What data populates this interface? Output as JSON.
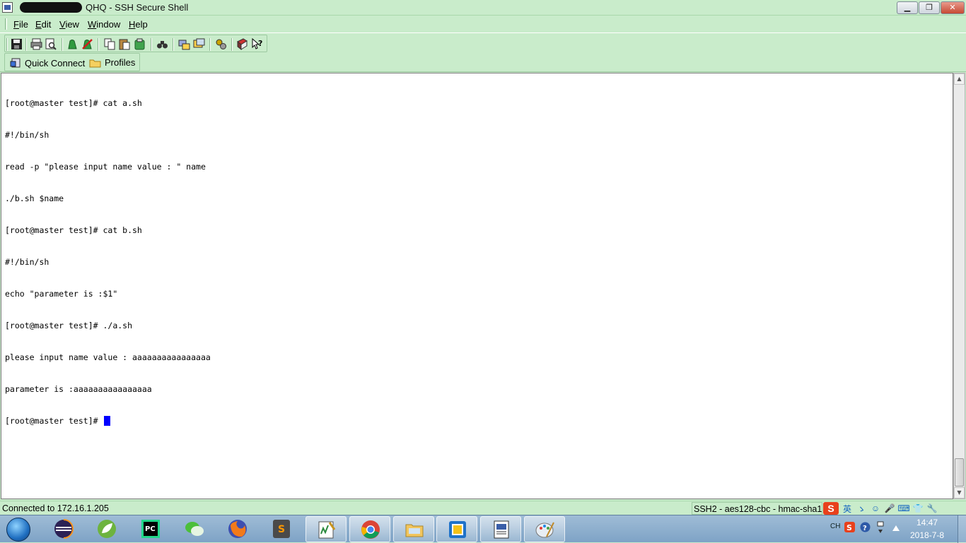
{
  "window": {
    "title": "QHQ - SSH Secure Shell",
    "controls": {
      "minimize": "▁",
      "maximize": "❐",
      "close": "✕"
    }
  },
  "menubar": {
    "items": [
      "File",
      "Edit",
      "View",
      "Window",
      "Help"
    ]
  },
  "toolbar": {
    "buttons": [
      "save-icon",
      "print-icon",
      "print-preview-icon",
      "connect-icon",
      "disconnect-icon",
      "copy-icon",
      "paste-icon",
      "paste-clipboard-icon",
      "find-icon",
      "file-transfer-icon",
      "new-terminal-icon",
      "settings-icon",
      "help-book-icon",
      "context-help-icon"
    ]
  },
  "quickconnect": {
    "quick_connect_label": "Quick Connect",
    "profiles_label": "Profiles"
  },
  "terminal": {
    "lines": [
      "[root@master test]# cat a.sh",
      "#!/bin/sh",
      "read -p \"please input name value : \" name",
      "./b.sh $name",
      "[root@master test]# cat b.sh",
      "#!/bin/sh",
      "echo \"parameter is :$1\"",
      "[root@master test]# ./a.sh",
      "please input name value : aaaaaaaaaaaaaaaa",
      "parameter is :aaaaaaaaaaaaaaaa",
      "[root@master test]# "
    ],
    "cursor_color": "#0000ff"
  },
  "statusbar": {
    "connection": "Connected to 172.16.1.205",
    "cipher": "SSH2 - aes128-cbc - hmac-sha1",
    "ime": [
      "S",
      "英",
      "ゝ",
      "☺",
      "🎤",
      "⌨",
      "👕",
      "🔧"
    ]
  },
  "taskbar": {
    "apps": [
      "eclipse-icon",
      "spring-icon",
      "pycharm-icon",
      "wechat-icon",
      "firefox-icon",
      "sublime-icon",
      "notepad-icon",
      "chrome-icon",
      "explorer-icon",
      "virtualbox-icon",
      "ssh-client-icon",
      "paint-icon"
    ],
    "tray": {
      "lang": "CH",
      "time": "14:47",
      "date": "2018-7-8"
    }
  },
  "colors": {
    "chrome_green": "#c9eccb",
    "terminal_bg": "#ffffff",
    "taskbar_blue": "#8fb0cf"
  }
}
